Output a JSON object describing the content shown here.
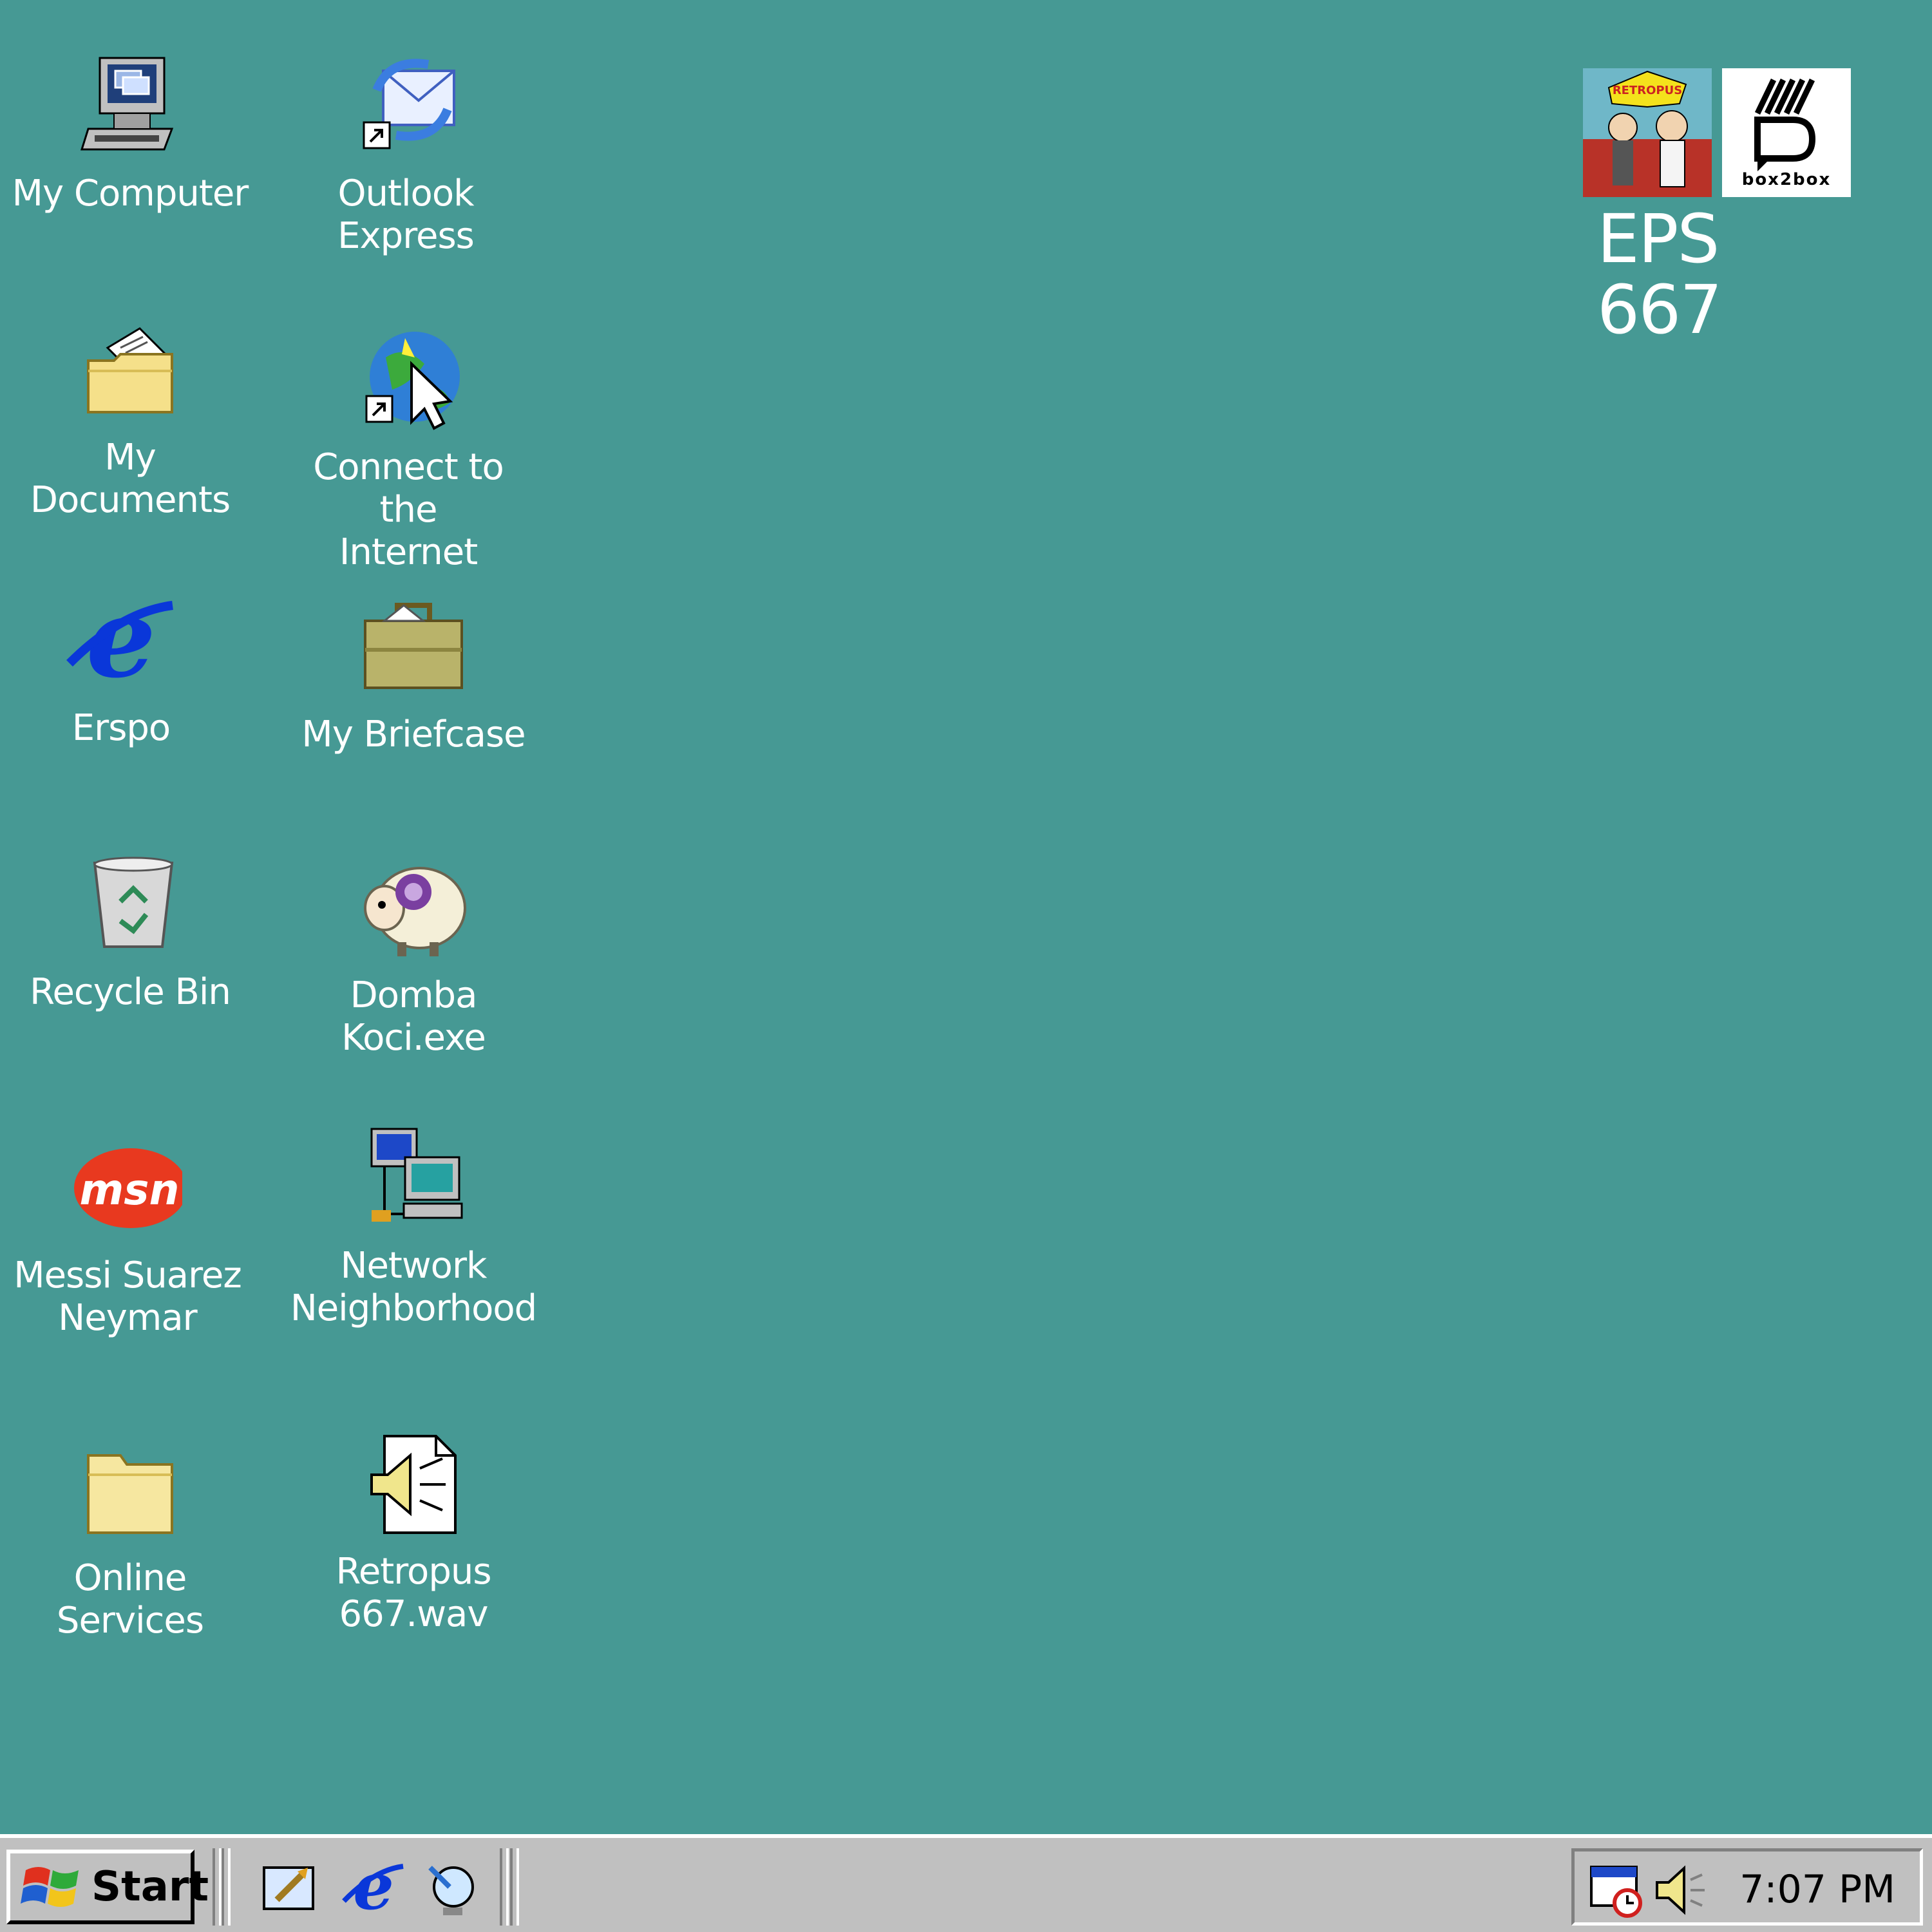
{
  "desktop": {
    "background_color": "#469994",
    "icons": [
      {
        "label": "My Computer",
        "icon": "my-computer-icon"
      },
      {
        "label": "Outlook\nExpress",
        "icon": "outlook-express-icon"
      },
      {
        "label": "My Documents",
        "icon": "my-documents-icon"
      },
      {
        "label": "Connect to the\nInternet",
        "icon": "connect-internet-icon"
      },
      {
        "label": "Erspo",
        "icon": "internet-explorer-icon"
      },
      {
        "label": "My Briefcase",
        "icon": "briefcase-icon"
      },
      {
        "label": "Recycle Bin",
        "icon": "recycle-bin-icon"
      },
      {
        "label": "Domba Koci.exe",
        "icon": "sheep-icon"
      },
      {
        "label": "Messi Suarez\nNeymar",
        "icon": "msn-icon"
      },
      {
        "label": "Network\nNeighborhood",
        "icon": "network-neighborhood-icon"
      },
      {
        "label": "Online\nServices",
        "icon": "folder-icon"
      },
      {
        "label": "Retropus\n667.wav",
        "icon": "wav-file-icon"
      }
    ]
  },
  "branding": {
    "cover_art_text": "RETROPUS",
    "logo_wordmark": "box2box",
    "episode": "EPS 667"
  },
  "taskbar": {
    "start_label": "Start",
    "quick_launch": [
      "show-desktop-icon",
      "internet-explorer-icon",
      "channels-icon"
    ],
    "tray_icons": [
      "task-scheduler-icon",
      "volume-icon"
    ],
    "clock": "7:07 PM"
  }
}
